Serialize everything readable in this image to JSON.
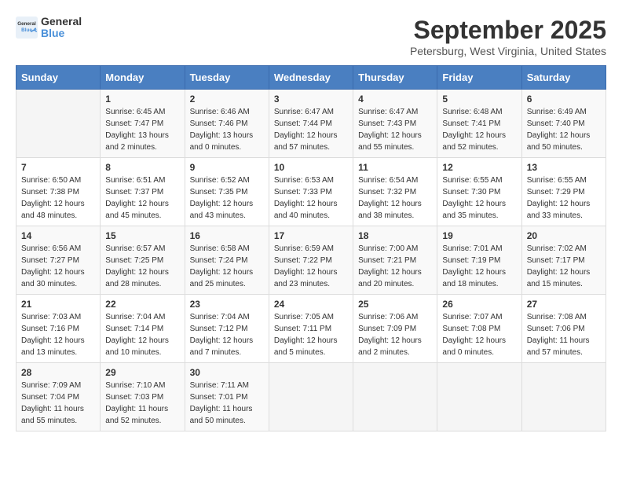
{
  "logo": {
    "general": "General",
    "blue": "Blue"
  },
  "title": "September 2025",
  "location": "Petersburg, West Virginia, United States",
  "weekdays": [
    "Sunday",
    "Monday",
    "Tuesday",
    "Wednesday",
    "Thursday",
    "Friday",
    "Saturday"
  ],
  "weeks": [
    [
      {
        "day": "",
        "content": ""
      },
      {
        "day": "1",
        "content": "Sunrise: 6:45 AM\nSunset: 7:47 PM\nDaylight: 13 hours\nand 2 minutes."
      },
      {
        "day": "2",
        "content": "Sunrise: 6:46 AM\nSunset: 7:46 PM\nDaylight: 13 hours\nand 0 minutes."
      },
      {
        "day": "3",
        "content": "Sunrise: 6:47 AM\nSunset: 7:44 PM\nDaylight: 12 hours\nand 57 minutes."
      },
      {
        "day": "4",
        "content": "Sunrise: 6:47 AM\nSunset: 7:43 PM\nDaylight: 12 hours\nand 55 minutes."
      },
      {
        "day": "5",
        "content": "Sunrise: 6:48 AM\nSunset: 7:41 PM\nDaylight: 12 hours\nand 52 minutes."
      },
      {
        "day": "6",
        "content": "Sunrise: 6:49 AM\nSunset: 7:40 PM\nDaylight: 12 hours\nand 50 minutes."
      }
    ],
    [
      {
        "day": "7",
        "content": "Sunrise: 6:50 AM\nSunset: 7:38 PM\nDaylight: 12 hours\nand 48 minutes."
      },
      {
        "day": "8",
        "content": "Sunrise: 6:51 AM\nSunset: 7:37 PM\nDaylight: 12 hours\nand 45 minutes."
      },
      {
        "day": "9",
        "content": "Sunrise: 6:52 AM\nSunset: 7:35 PM\nDaylight: 12 hours\nand 43 minutes."
      },
      {
        "day": "10",
        "content": "Sunrise: 6:53 AM\nSunset: 7:33 PM\nDaylight: 12 hours\nand 40 minutes."
      },
      {
        "day": "11",
        "content": "Sunrise: 6:54 AM\nSunset: 7:32 PM\nDaylight: 12 hours\nand 38 minutes."
      },
      {
        "day": "12",
        "content": "Sunrise: 6:55 AM\nSunset: 7:30 PM\nDaylight: 12 hours\nand 35 minutes."
      },
      {
        "day": "13",
        "content": "Sunrise: 6:55 AM\nSunset: 7:29 PM\nDaylight: 12 hours\nand 33 minutes."
      }
    ],
    [
      {
        "day": "14",
        "content": "Sunrise: 6:56 AM\nSunset: 7:27 PM\nDaylight: 12 hours\nand 30 minutes."
      },
      {
        "day": "15",
        "content": "Sunrise: 6:57 AM\nSunset: 7:25 PM\nDaylight: 12 hours\nand 28 minutes."
      },
      {
        "day": "16",
        "content": "Sunrise: 6:58 AM\nSunset: 7:24 PM\nDaylight: 12 hours\nand 25 minutes."
      },
      {
        "day": "17",
        "content": "Sunrise: 6:59 AM\nSunset: 7:22 PM\nDaylight: 12 hours\nand 23 minutes."
      },
      {
        "day": "18",
        "content": "Sunrise: 7:00 AM\nSunset: 7:21 PM\nDaylight: 12 hours\nand 20 minutes."
      },
      {
        "day": "19",
        "content": "Sunrise: 7:01 AM\nSunset: 7:19 PM\nDaylight: 12 hours\nand 18 minutes."
      },
      {
        "day": "20",
        "content": "Sunrise: 7:02 AM\nSunset: 7:17 PM\nDaylight: 12 hours\nand 15 minutes."
      }
    ],
    [
      {
        "day": "21",
        "content": "Sunrise: 7:03 AM\nSunset: 7:16 PM\nDaylight: 12 hours\nand 13 minutes."
      },
      {
        "day": "22",
        "content": "Sunrise: 7:04 AM\nSunset: 7:14 PM\nDaylight: 12 hours\nand 10 minutes."
      },
      {
        "day": "23",
        "content": "Sunrise: 7:04 AM\nSunset: 7:12 PM\nDaylight: 12 hours\nand 7 minutes."
      },
      {
        "day": "24",
        "content": "Sunrise: 7:05 AM\nSunset: 7:11 PM\nDaylight: 12 hours\nand 5 minutes."
      },
      {
        "day": "25",
        "content": "Sunrise: 7:06 AM\nSunset: 7:09 PM\nDaylight: 12 hours\nand 2 minutes."
      },
      {
        "day": "26",
        "content": "Sunrise: 7:07 AM\nSunset: 7:08 PM\nDaylight: 12 hours\nand 0 minutes."
      },
      {
        "day": "27",
        "content": "Sunrise: 7:08 AM\nSunset: 7:06 PM\nDaylight: 11 hours\nand 57 minutes."
      }
    ],
    [
      {
        "day": "28",
        "content": "Sunrise: 7:09 AM\nSunset: 7:04 PM\nDaylight: 11 hours\nand 55 minutes."
      },
      {
        "day": "29",
        "content": "Sunrise: 7:10 AM\nSunset: 7:03 PM\nDaylight: 11 hours\nand 52 minutes."
      },
      {
        "day": "30",
        "content": "Sunrise: 7:11 AM\nSunset: 7:01 PM\nDaylight: 11 hours\nand 50 minutes."
      },
      {
        "day": "",
        "content": ""
      },
      {
        "day": "",
        "content": ""
      },
      {
        "day": "",
        "content": ""
      },
      {
        "day": "",
        "content": ""
      }
    ]
  ]
}
